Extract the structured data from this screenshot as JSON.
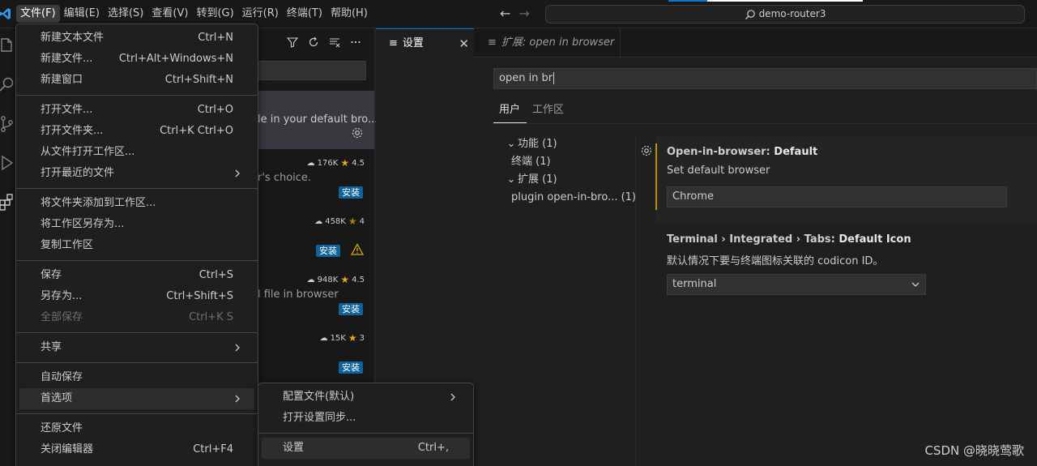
{
  "titlebar": {
    "menus": [
      "文件(F)",
      "编辑(E)",
      "选择(S)",
      "查看(V)",
      "转到(G)",
      "运行(R)",
      "终端(T)",
      "帮助(H)"
    ],
    "active_menu_index": 0,
    "search_text": "demo-router3"
  },
  "sidebar": {
    "extensions": [
      {
        "desc": "le in your default bro...",
        "stats": "",
        "rating": "",
        "install": "",
        "selected": true
      },
      {
        "desc": "r's choice.",
        "stats": "176K",
        "rating": "4.5",
        "install": "安装"
      },
      {
        "desc": "",
        "stats": "458K",
        "rating": "4",
        "install": "安装",
        "warning": true
      },
      {
        "desc": "l file in browser",
        "stats": "948K",
        "rating": "4.5",
        "install": "安装"
      },
      {
        "desc": "",
        "stats": "15K",
        "rating": "3",
        "install": "安装"
      }
    ]
  },
  "tabs": {
    "active": {
      "label": "设置"
    },
    "inactive": {
      "label": "扩展: open in browser"
    }
  },
  "settings": {
    "search_value": "open in br",
    "scope_tabs": [
      "用户",
      "工作区"
    ],
    "toc": [
      {
        "label": "功能 (1)",
        "indent": 0,
        "chevron": "⌄"
      },
      {
        "label": "终端 (1)",
        "indent": 1,
        "chevron": ""
      },
      {
        "label": "扩展 (1)",
        "indent": 0,
        "chevron": "⌄"
      },
      {
        "label": "plugin open-in-bro... (1)",
        "indent": 1,
        "chevron": ""
      }
    ],
    "items": [
      {
        "category": "Open-in-browser: ",
        "name": "Default",
        "description": "Set default browser",
        "value": "Chrome"
      },
      {
        "category": "Terminal › Integrated › Tabs: ",
        "name": "Default Icon",
        "description": "默认情况下要与终端图标关联的 codicon ID。",
        "value": "terminal"
      }
    ]
  },
  "file_menu": {
    "groups": [
      [
        {
          "label": "新建文本文件",
          "key": "Ctrl+N"
        },
        {
          "label": "新建文件...",
          "key": "Ctrl+Alt+Windows+N"
        },
        {
          "label": "新建窗口",
          "key": "Ctrl+Shift+N"
        }
      ],
      [
        {
          "label": "打开文件...",
          "key": "Ctrl+O"
        },
        {
          "label": "打开文件夹...",
          "key": "Ctrl+K Ctrl+O"
        },
        {
          "label": "从文件打开工作区...",
          "key": ""
        },
        {
          "label": "打开最近的文件",
          "key": "",
          "submenu": true
        }
      ],
      [
        {
          "label": "将文件夹添加到工作区...",
          "key": ""
        },
        {
          "label": "将工作区另存为...",
          "key": ""
        },
        {
          "label": "复制工作区",
          "key": ""
        }
      ],
      [
        {
          "label": "保存",
          "key": "Ctrl+S"
        },
        {
          "label": "另存为...",
          "key": "Ctrl+Shift+S"
        },
        {
          "label": "全部保存",
          "key": "Ctrl+K S",
          "disabled": true
        }
      ],
      [
        {
          "label": "共享",
          "key": "",
          "submenu": true
        }
      ],
      [
        {
          "label": "自动保存",
          "key": ""
        },
        {
          "label": "首选项",
          "key": "",
          "submenu": true,
          "highlighted": true
        }
      ],
      [
        {
          "label": "还原文件",
          "key": ""
        },
        {
          "label": "关闭编辑器",
          "key": "Ctrl+F4"
        }
      ]
    ]
  },
  "preferences_submenu": {
    "groups": [
      [
        {
          "label": "配置文件(默认)",
          "key": "",
          "submenu": true
        },
        {
          "label": "打开设置同步...",
          "key": ""
        }
      ],
      [
        {
          "label": "设置",
          "key": "Ctrl+,",
          "highlighted": true
        }
      ]
    ]
  },
  "watermark": "CSDN @晓晓莺歌",
  "colors": {
    "accent": "#0078d4",
    "install": "#0e639c",
    "modified_bar": "#b89500",
    "star": "#e8a317"
  }
}
